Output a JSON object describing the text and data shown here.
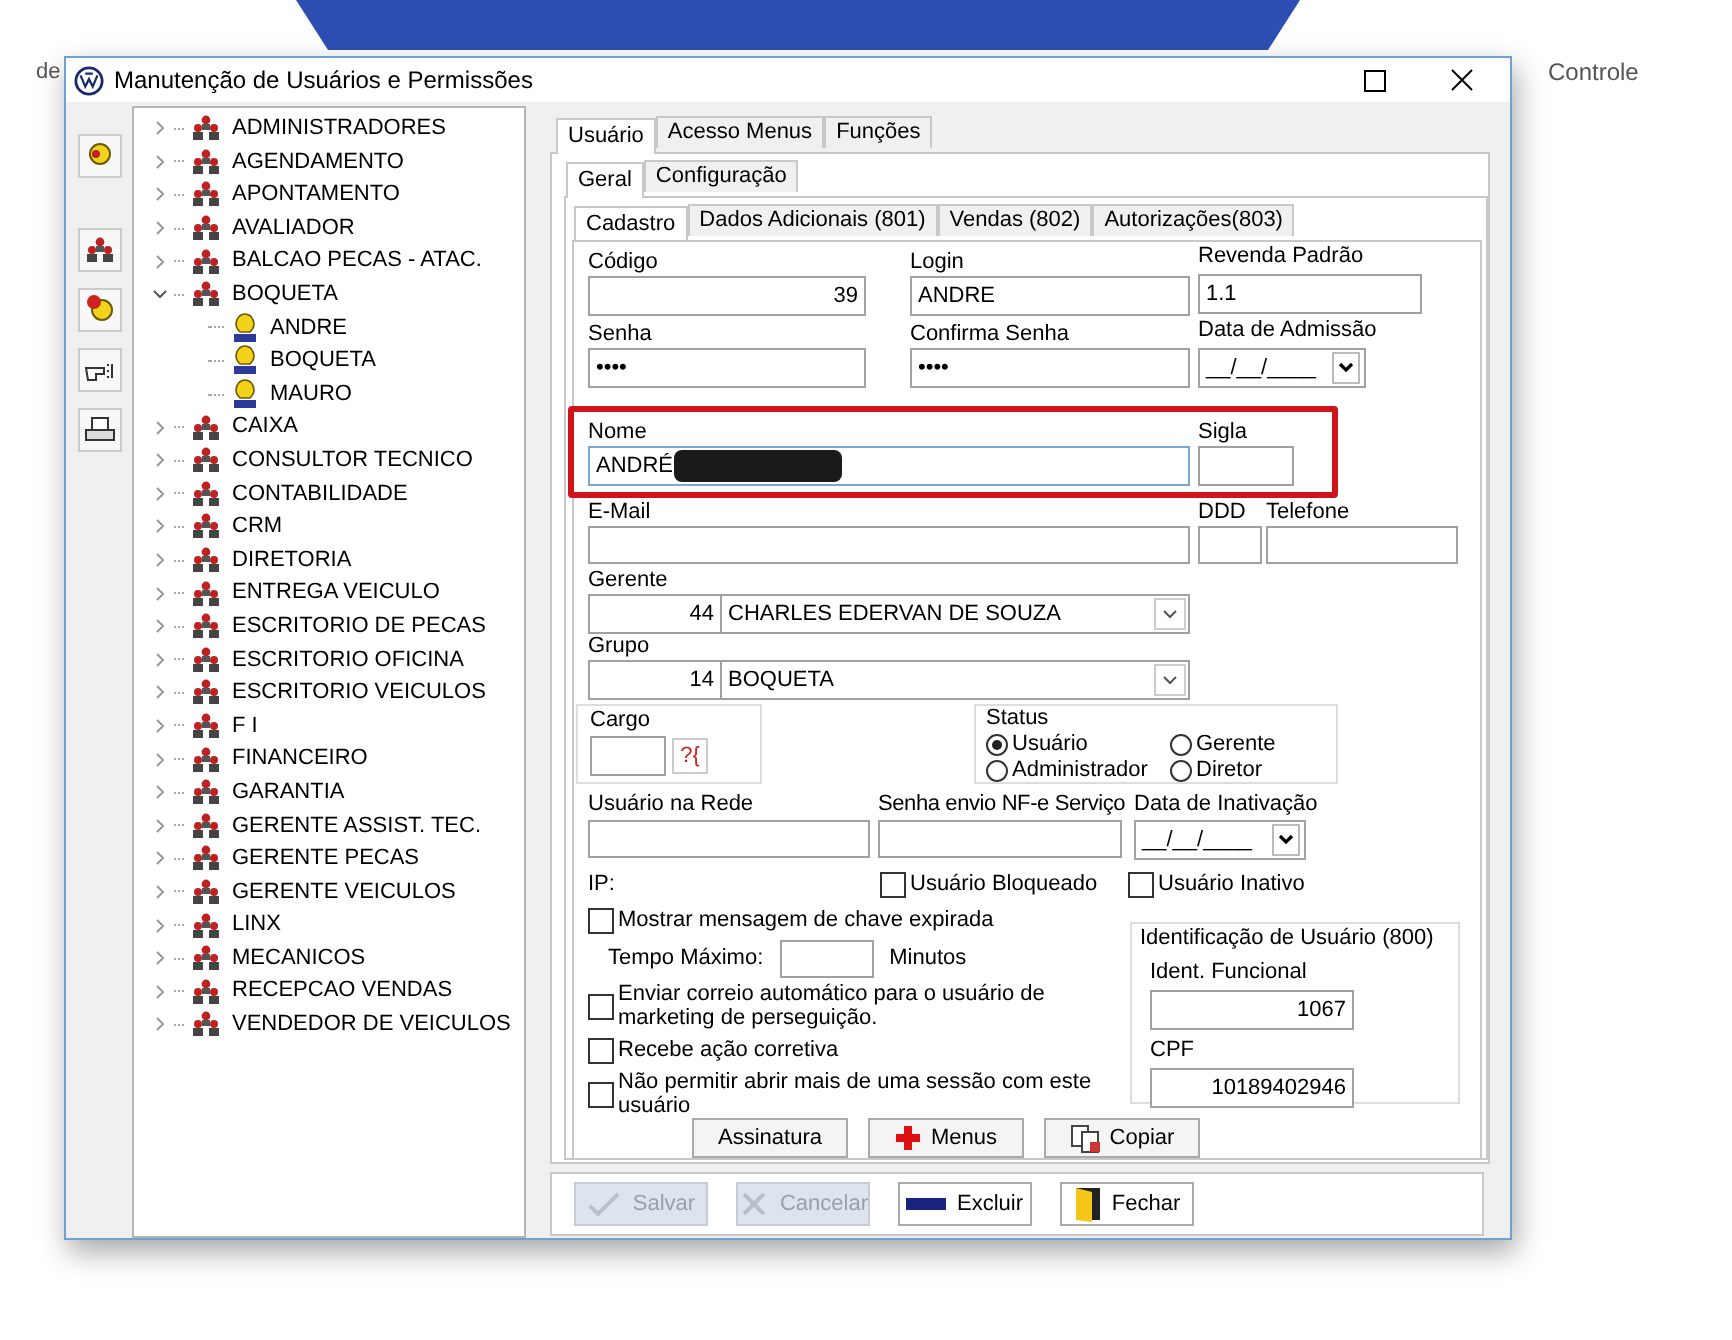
{
  "backdrop": {
    "left_text": "de",
    "right_text": "Controle"
  },
  "window": {
    "title": "Manutenção de Usuários e Permissões"
  },
  "tree": [
    {
      "label": "ADMINISTRADORES",
      "expanded": false
    },
    {
      "label": "AGENDAMENTO",
      "expanded": false
    },
    {
      "label": "APONTAMENTO",
      "expanded": false
    },
    {
      "label": "AVALIADOR",
      "expanded": false
    },
    {
      "label": "BALCAO PECAS - ATAC.",
      "expanded": false
    },
    {
      "label": "BOQUETA",
      "expanded": true,
      "children": [
        {
          "label": "ANDRE"
        },
        {
          "label": "BOQUETA"
        },
        {
          "label": "MAURO"
        }
      ]
    },
    {
      "label": "CAIXA",
      "expanded": false
    },
    {
      "label": "CONSULTOR TECNICO",
      "expanded": false
    },
    {
      "label": "CONTABILIDADE",
      "expanded": false
    },
    {
      "label": "CRM",
      "expanded": false
    },
    {
      "label": "DIRETORIA",
      "expanded": false
    },
    {
      "label": "ENTREGA VEICULO",
      "expanded": false
    },
    {
      "label": "ESCRITORIO DE PECAS",
      "expanded": false
    },
    {
      "label": "ESCRITORIO OFICINA",
      "expanded": false
    },
    {
      "label": "ESCRITORIO VEICULOS",
      "expanded": false
    },
    {
      "label": "F I",
      "expanded": false
    },
    {
      "label": "FINANCEIRO",
      "expanded": false
    },
    {
      "label": "GARANTIA",
      "expanded": false
    },
    {
      "label": "GERENTE ASSIST. TEC.",
      "expanded": false
    },
    {
      "label": "GERENTE PECAS",
      "expanded": false
    },
    {
      "label": "GERENTE VEICULOS",
      "expanded": false
    },
    {
      "label": "LINX",
      "expanded": false
    },
    {
      "label": "MECANICOS",
      "expanded": false
    },
    {
      "label": "RECEPCAO VENDAS",
      "expanded": false
    },
    {
      "label": "VENDEDOR DE VEICULOS",
      "expanded": false
    }
  ],
  "tabs": [
    {
      "label": "Usuário",
      "selected": true
    },
    {
      "label": "Acesso Menus",
      "selected": false
    },
    {
      "label": "Funções",
      "selected": false
    }
  ],
  "subtabs": [
    {
      "label": "Geral",
      "selected": true
    },
    {
      "label": "Configuração",
      "selected": false
    }
  ],
  "section_tabs": [
    {
      "label": "Cadastro",
      "selected": true
    },
    {
      "label": "Dados Adicionais (801)",
      "selected": false
    },
    {
      "label": "Vendas (802)",
      "selected": false
    },
    {
      "label": "Autorizações(803)",
      "selected": false
    }
  ],
  "form": {
    "codigo": {
      "label": "Código",
      "value": "39"
    },
    "login": {
      "label": "Login",
      "value": "ANDRE"
    },
    "revenda": {
      "label": "Revenda Padrão",
      "value": "1.1"
    },
    "senha": {
      "label": "Senha",
      "value": "••••"
    },
    "confirma": {
      "label": "Confirma Senha",
      "value": "••••"
    },
    "admissao": {
      "label": "Data de Admissão",
      "value": "__/__/____"
    },
    "nome": {
      "label": "Nome",
      "value": "ANDRÉ",
      "redacted": true
    },
    "sigla": {
      "label": "Sigla"
    },
    "email": {
      "label": "E-Mail"
    },
    "ddd": {
      "label": "DDD"
    },
    "telefone": {
      "label": "Telefone"
    },
    "gerente": {
      "label": "Gerente",
      "code": "44",
      "value": "CHARLES EDERVAN DE SOUZA"
    },
    "grupo": {
      "label": "Grupo",
      "code": "14",
      "value": "BOQUETA"
    },
    "cargo": {
      "label": "Cargo",
      "lookup": "?{"
    },
    "status": {
      "label": "Status",
      "options": [
        {
          "label": "Usuário",
          "selected": true
        },
        {
          "label": "Gerente",
          "selected": false
        },
        {
          "label": "Administrador",
          "selected": false
        },
        {
          "label": "Diretor",
          "selected": false
        }
      ]
    },
    "usuario_rede": {
      "label": "Usuário na Rede"
    },
    "senha_nfe": {
      "label": "Senha envio NF-e Serviço"
    },
    "inativacao": {
      "label": "Data de Inativação",
      "value": "__/__/____"
    },
    "ip_label": "IP:",
    "ip_checks": [
      {
        "label": "Usuário Bloqueado",
        "checked": false
      },
      {
        "label": "Usuário Inativo",
        "checked": false
      }
    ],
    "expired_check": {
      "label": "Mostrar mensagem de chave expirada",
      "checked": false
    },
    "tempo": {
      "label": "Tempo Máximo:",
      "unit": "Minutos"
    },
    "options": [
      {
        "label": "Enviar correio automático para o usuário de marketing de perseguição.",
        "checked": false
      },
      {
        "label": "Recebe ação corretiva",
        "checked": false
      },
      {
        "label": "Não permitir abrir mais de uma sessão com este usuário",
        "checked": false
      }
    ],
    "ident": {
      "title": "Identificação de Usuário (800)",
      "funcional": {
        "label": "Ident. Funcional",
        "value": "1067"
      },
      "cpf": {
        "label": "CPF",
        "value": "10189402946"
      }
    },
    "action_buttons": [
      {
        "label": "Assinatura",
        "kind": "plain"
      },
      {
        "label": "Menus",
        "kind": "plus"
      },
      {
        "label": "Copiar",
        "kind": "copy"
      }
    ]
  },
  "footer_buttons": [
    {
      "label": "Salvar",
      "kind": "check",
      "disabled": true
    },
    {
      "label": "Cancelar",
      "kind": "cancel",
      "disabled": true
    },
    {
      "label": "Excluir",
      "kind": "minus",
      "disabled": false
    },
    {
      "label": "Fechar",
      "kind": "door",
      "disabled": false
    }
  ]
}
